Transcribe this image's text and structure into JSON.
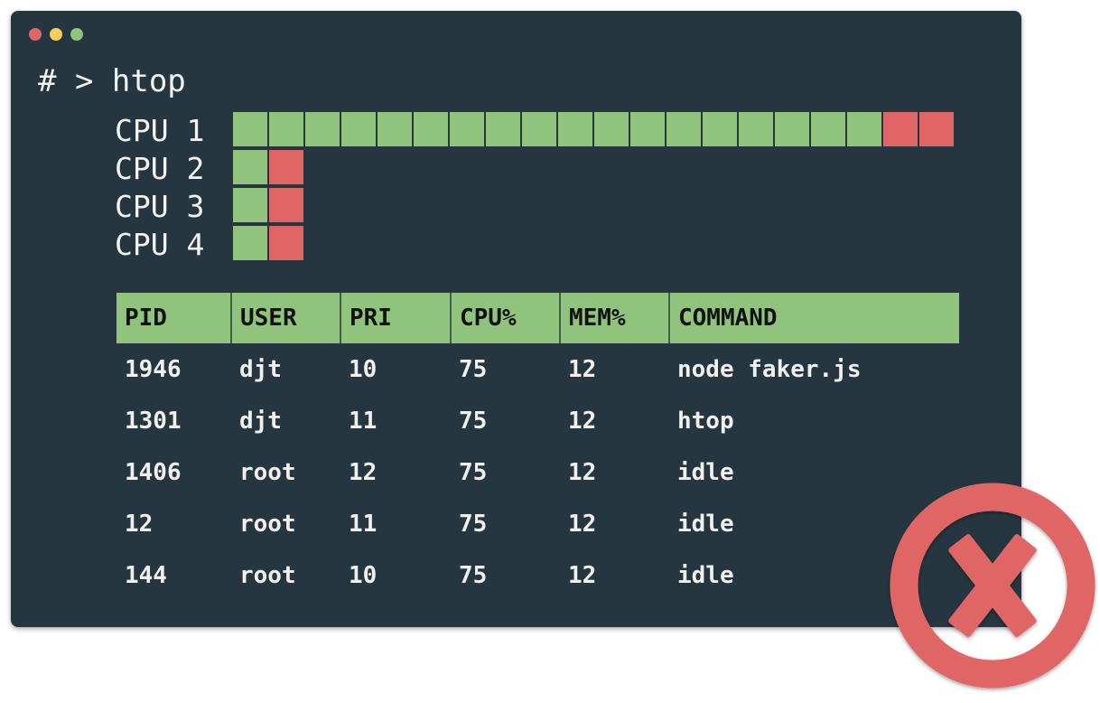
{
  "window": {
    "controls": [
      {
        "name": "close",
        "color": "#e06666"
      },
      {
        "name": "minimize",
        "color": "#f6cf57"
      },
      {
        "name": "maximize",
        "color": "#90c47d"
      }
    ]
  },
  "terminal": {
    "prompt": "# > htop"
  },
  "colors": {
    "background": "#263640",
    "used": "#90c47d",
    "overload": "#e06666",
    "text": "#f3f3f3"
  },
  "cpus": [
    {
      "label": "CPU 1",
      "green_blocks": 18,
      "red_blocks": 2
    },
    {
      "label": "CPU 2",
      "green_blocks": 1,
      "red_blocks": 1
    },
    {
      "label": "CPU 3",
      "green_blocks": 1,
      "red_blocks": 1
    },
    {
      "label": "CPU 4",
      "green_blocks": 1,
      "red_blocks": 1
    }
  ],
  "process_table": {
    "headers": [
      "PID",
      "USER",
      "PRI",
      "CPU%",
      "MEM%",
      "COMMAND"
    ],
    "rows": [
      [
        "1946",
        "djt",
        "10",
        "75",
        "12",
        "node faker.js"
      ],
      [
        "1301",
        "djt",
        "11",
        "75",
        "12",
        "htop"
      ],
      [
        "1406",
        "root",
        "12",
        "75",
        "12",
        "idle"
      ],
      [
        "12",
        "root",
        "11",
        "75",
        "12",
        "idle"
      ],
      [
        "144",
        "root",
        "10",
        "75",
        "12",
        "idle"
      ]
    ]
  },
  "status_badge": {
    "icon": "x-circle-icon",
    "meaning": "error",
    "color": "#e06666"
  }
}
